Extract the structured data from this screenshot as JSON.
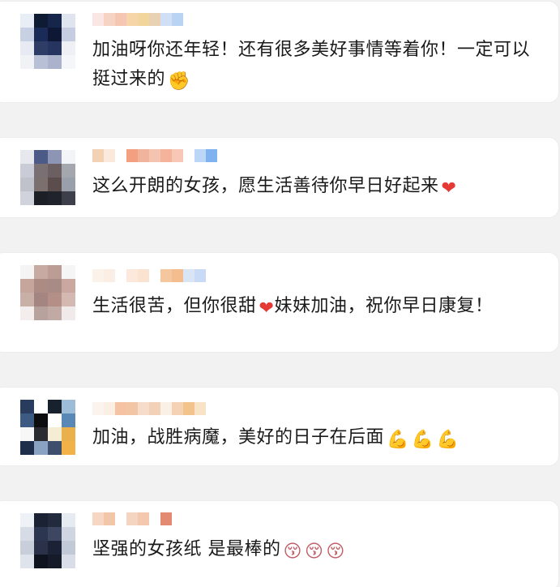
{
  "comments": [
    {
      "text": "加油呀你还年轻！还有很多美好事情等着你！一定可以挺过来的",
      "emoji": "✊",
      "emoji_name": "raised-fist-icon",
      "name_colors": [
        "#fbe6e6",
        "#f6d3c2",
        "#f5c7b3",
        "#f6d6a8",
        "#f2d59a",
        "#e9d2b4",
        "#cfe0f6",
        "#b9d3f3"
      ],
      "avatar_colors": [
        "#e9edf5",
        "#0f1a33",
        "#16254a",
        "#dfe4ee",
        "#c8d0e3",
        "#1a2b57",
        "#0e1834",
        "#c7cde0",
        "#e7eaf2",
        "#2e3d66",
        "#25355f",
        "#eef0f5",
        "#f1f2f6",
        "#b8c0d5",
        "#aab3cb",
        "#f5f6f9"
      ]
    },
    {
      "text": "这么开朗的女孩，愿生活善待你早日好起来",
      "emoji": "❤",
      "emoji_name": "red-heart-icon",
      "name_colors": [
        "#f3d1b4",
        "#fbe9dc",
        "#ffffff",
        "#f2a07f",
        "#f0b39b",
        "#f4c4b0",
        "#f6b39c",
        "#f7c8b5",
        "#ffffff",
        "#bcd6f7",
        "#7fb3f0"
      ],
      "avatar_colors": [
        "#e6e8ee",
        "#4b5a86",
        "#8c95b4",
        "#f3f4f7",
        "#c9ccd6",
        "#7a6f73",
        "#6c5f62",
        "#a5a7ae",
        "#bfc2cb",
        "#7c706e",
        "#5b4d4c",
        "#9aa0ab",
        "#d0d3db",
        "#1d1f27",
        "#20232c",
        "#3d404a"
      ]
    },
    {
      "text": "生活很苦，但你很甜",
      "emoji": "❤",
      "emoji_name": "red-heart-icon",
      "text_after": "妹妹加油，祝你早日康复！",
      "name_colors": [
        "#fbf3ea",
        "#fbeee4",
        "#ffffff",
        "#fde8dc",
        "#fbe3d2",
        "#ffffff",
        "#f5c79e",
        "#f3bd8e",
        "#d9e4f5",
        "#c8daf6"
      ],
      "avatar_colors": [
        "#f5f4f5",
        "#c7aaa2",
        "#bb9d96",
        "#f6f5f6",
        "#c5a59c",
        "#ac8b84",
        "#a88b85",
        "#caa89f",
        "#c9b0a7",
        "#a48581",
        "#b38f88",
        "#d3b9b1",
        "#f3eeed",
        "#b7a29e",
        "#c1aaa4",
        "#f0eaea"
      ]
    },
    {
      "text": "加油，战胜病魔，美好的日子在后面",
      "emojis": [
        "💪",
        "💪",
        "💪"
      ],
      "emoji_name": "flexed-biceps-icon",
      "name_colors": [
        "#fbf4ee",
        "#fbefe4",
        "#f5c2a4",
        "#f3c5a7",
        "#f8dccb",
        "#f2d1b9",
        "#fbf0e6",
        "#f4d2b3",
        "#f2c48b",
        "#f9e3c6"
      ],
      "avatar_colors": [
        "#2a3c5e",
        "#ffffff",
        "#18212e",
        "#9cbcd8",
        "#3d5a83",
        "#0d0d0f",
        "#ffffff",
        "#5a88b6",
        "#f7f7f7",
        "#2a2a31",
        "#f5ecd4",
        "#e9b04b",
        "#1f2e4b",
        "#8aa3c2",
        "#3e4f6b",
        "#f3b247"
      ]
    },
    {
      "text": "坚强的女孩纸 是最棒的",
      "emojis": [
        "😚",
        "😚",
        "😚"
      ],
      "emoji_name": "kissing-face-icon",
      "name_colors": [
        "#f5d7c3",
        "#f2c7a9",
        "#ffffff",
        "#f4d5c2",
        "#f3c8ae",
        "#ffffff",
        "#e48a73"
      ],
      "avatar_colors": [
        "#eef1f6",
        "#1b2233",
        "#222a3d",
        "#e6eaf1",
        "#d6dbe6",
        "#2d3650",
        "#3e4762",
        "#cfd5e1",
        "#c8ceda",
        "#2b3148",
        "#1c2235",
        "#c2c9d6",
        "#dfe3eb",
        "#0f131f",
        "#161b2a",
        "#d8dde7"
      ]
    }
  ]
}
